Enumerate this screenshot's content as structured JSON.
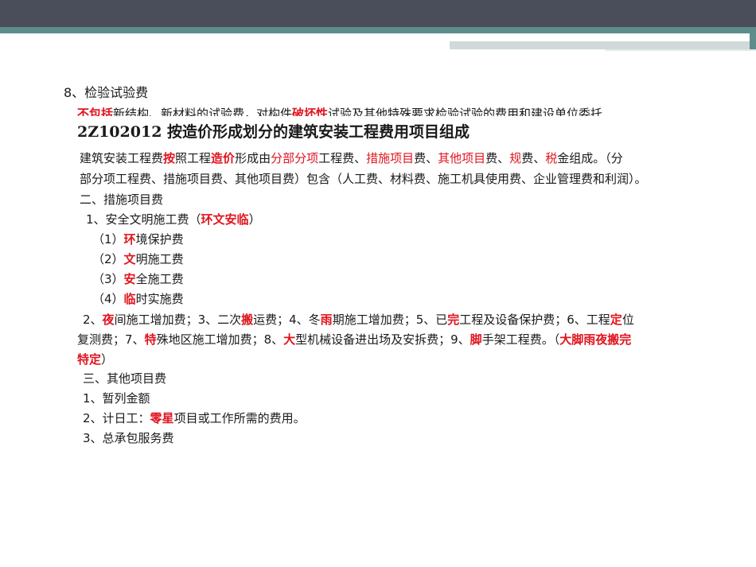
{
  "old": {
    "heading": "8、检验试验费",
    "line_red": "不包括",
    "line_a": "新结构、新材料的试验费，对构件",
    "line_red2": "破坏性",
    "line_b": "试验及其他特殊要求检验试验的费用和建设单位委托"
  },
  "section_title": "2Z102012  按造价形成划分的建筑安装工程费用项目组成",
  "intro": {
    "t1": "建筑安装工程费",
    "r1": "按",
    "t2": "照工程",
    "r2": "造价",
    "t3": "形成由",
    "r3": "分部分项",
    "t4": "工程费、",
    "r4": "措施项目",
    "t5": "费、",
    "r5": "其他项目",
    "t6": "费、",
    "r6": "规",
    "t7": "费、",
    "r7": "税",
    "t8": "金组成。（分",
    "line2": "部分项工程费、措施项目费、其他项目费）包含（人工费、材料费、施工机具使用费、企业管理费和利润）。"
  },
  "measures": {
    "heading": "二、措施项目费",
    "item1_a": "1、安全文明施工费（",
    "item1_r": "环文安临",
    "item1_b": "）",
    "sub": [
      {
        "num": "（1）",
        "red": "环",
        "rest": "境保护费"
      },
      {
        "num": "（2）",
        "red": "文",
        "rest": "明施工费"
      },
      {
        "num": "（3）",
        "red": "安",
        "rest": "全施工费"
      },
      {
        "num": "（4）",
        "red": "临",
        "rest": "时实施费"
      }
    ],
    "item2": {
      "t1": "2、",
      "r1": "夜",
      "t2": "间施工增加费；3、二次",
      "r2": "搬",
      "t3": "运费；4、冬",
      "r3": "雨",
      "t4": "期施工增加费；5、已",
      "r4": "完",
      "t5": "工程及设备保护费；6、工程",
      "r5": "定",
      "t6": "位",
      "l2_t1": "复测费；7、",
      "l2_r1": "特",
      "l2_t2": "殊地区施工增加费；8、",
      "l2_r2": "大",
      "l2_t3": "型机械设备进出场及安拆费；9、",
      "l2_r3": "脚",
      "l2_t4": "手架工程费。（",
      "l2_r4": "大脚雨夜搬完",
      "l3_r": "特定",
      "l3_t": "）"
    }
  },
  "others": {
    "heading": "三、其他项目费",
    "item1": "1、暂列金额",
    "item2_a": "2、计日工：",
    "item2_r": "零星",
    "item2_b": "项目或工作所需的费用。",
    "item3": "3、总承包服务费"
  }
}
